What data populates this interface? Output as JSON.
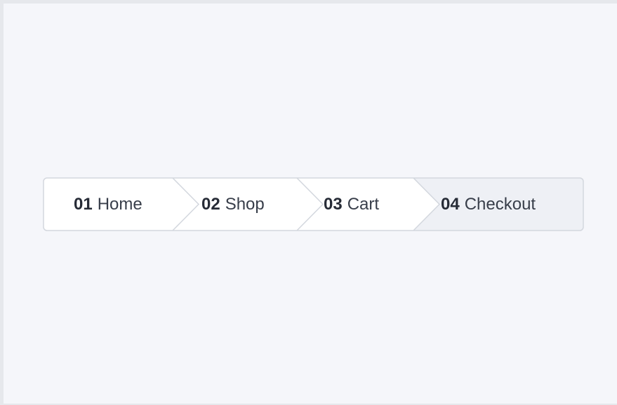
{
  "breadcrumb": {
    "items": [
      {
        "number": "01",
        "label": "Home",
        "active": false
      },
      {
        "number": "02",
        "label": "Shop",
        "active": false
      },
      {
        "number": "03",
        "label": "Cart",
        "active": false
      },
      {
        "number": "04",
        "label": "Checkout",
        "active": true
      }
    ]
  },
  "colors": {
    "background": "#f5f6fa",
    "item": "#ffffff",
    "active_item": "#eef0f5",
    "border": "#d3d7de",
    "text": "#2e3440"
  }
}
